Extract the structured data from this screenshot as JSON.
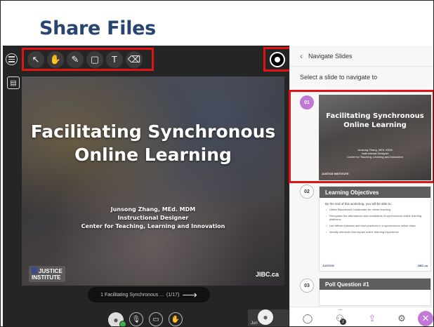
{
  "page": {
    "title": "Share Files"
  },
  "toolbar": {
    "tools": [
      {
        "name": "select-pointer-icon",
        "glyph": "↖"
      },
      {
        "name": "pan-hand-icon",
        "glyph": "✋"
      },
      {
        "name": "pen-icon",
        "glyph": "✎"
      },
      {
        "name": "rectangle-icon",
        "glyph": "▢"
      },
      {
        "name": "text-icon",
        "glyph": "T"
      },
      {
        "name": "eraser-icon",
        "glyph": "⌫"
      }
    ]
  },
  "slide": {
    "title_line1": "Facilitating Synchronous",
    "title_line2": "Online Learning",
    "author": "Junsong Zhang, MEd. MDM",
    "role": "Instructional Designer",
    "dept": "Center for Teaching, Learning and Innovation",
    "logo_line1": "JUSTICE",
    "logo_line2": "INSTITUTE",
    "site": "JIBC.ca"
  },
  "pager": {
    "label": "1 Facilitating Synchronous ...",
    "count": "(1/17)",
    "next": "⟶"
  },
  "participant": {
    "name": "Jun"
  },
  "panel": {
    "back": "‹",
    "title": "Navigate Slides",
    "subtitle": "Select a slide to navigate to",
    "slides": [
      {
        "number": "01",
        "title_line1": "Facilitating Synchronous",
        "title_line2": "Online Learning",
        "caption_1": "Junsong Zhang, MEd. MDM",
        "caption_2": "Instructional Designer",
        "caption_3": "Center for Teaching, Learning and Innovation",
        "logo": "JUSTICE INSTITUTE"
      },
      {
        "number": "02",
        "title": "Learning Objectives",
        "intro": "By the end of this workshop, you will be able to:",
        "bullets": [
          "Utilize Blackboard Collaborate for online teaching",
          "Recognize the affordances and constraints of synchronous online learning platforms",
          "List different phases and best practices in a synchronous online class",
          "Identify elements that impact online learning experience"
        ],
        "logo": "JUSTICE",
        "site": "JIBC.ca"
      },
      {
        "number": "03",
        "title": "Poll Question #1"
      }
    ]
  },
  "panel_bottom": {
    "badge": "2",
    "dots": "•••",
    "close": "✕"
  },
  "colors": {
    "accent": "#c07ad6",
    "highlight": "#e01414",
    "heading": "#28456f"
  }
}
